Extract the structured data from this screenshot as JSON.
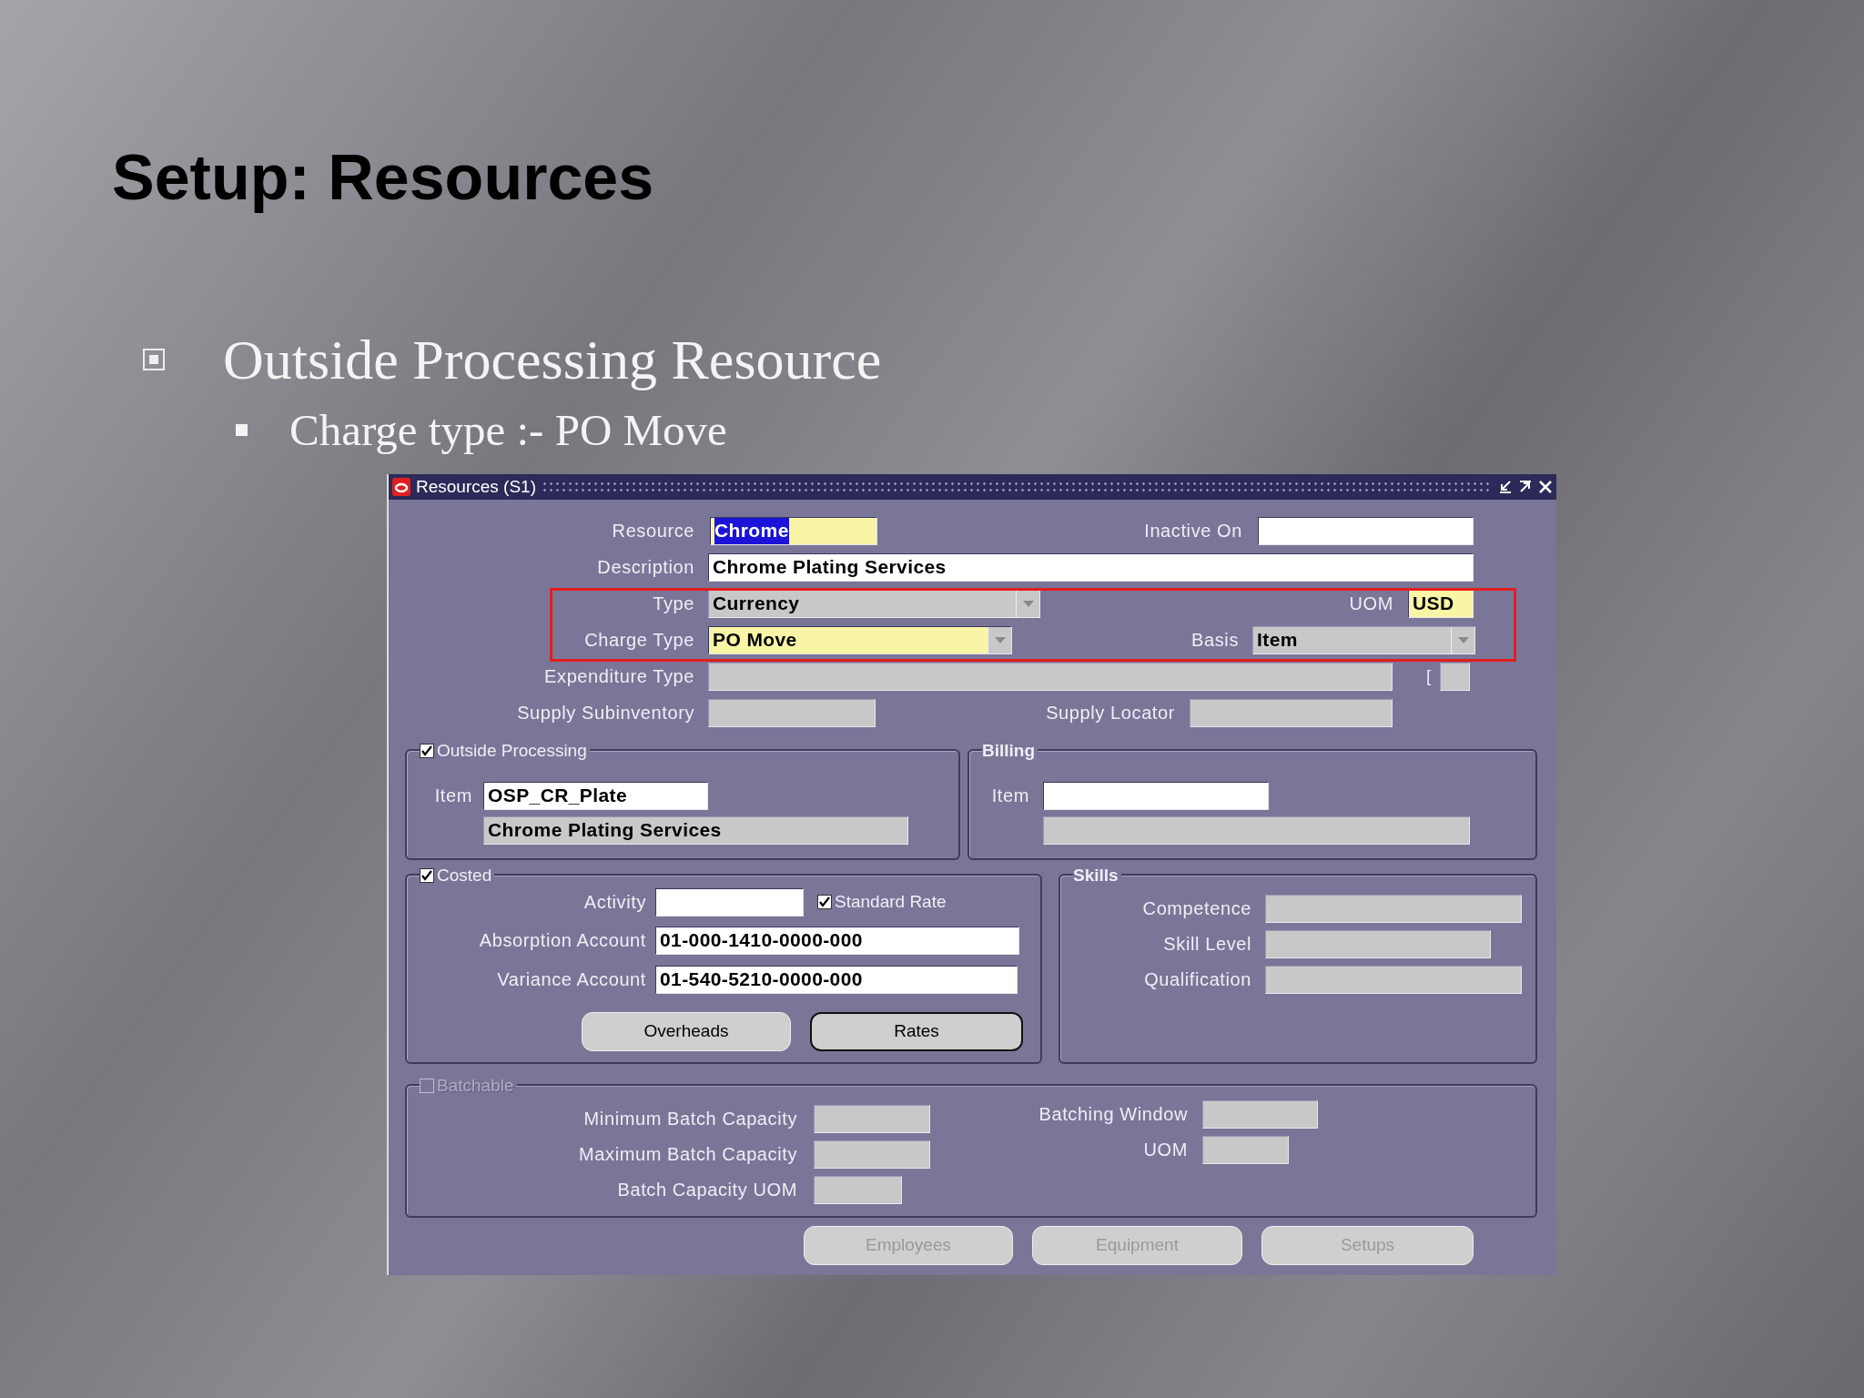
{
  "slide": {
    "title": "Setup: Resources",
    "bullets": [
      {
        "text": "Outside Processing Resource",
        "children": [
          {
            "text": "Charge type :- PO Move"
          }
        ]
      }
    ]
  },
  "window": {
    "title": "Resources (S1)",
    "resource": {
      "label": "Resource",
      "value": "Chrome",
      "dropdown": false,
      "required": true,
      "disabled": false,
      "highlighted": true
    },
    "inactive_on": {
      "label": "Inactive On",
      "dropdown": false,
      "required": false,
      "disabled": false
    },
    "description": {
      "label": "Description",
      "value": "Chrome Plating Services",
      "dropdown": false,
      "required": false,
      "disabled": false
    },
    "type": {
      "label": "Type",
      "value": "Currency",
      "dropdown": true,
      "required": false,
      "disabled": true
    },
    "uom": {
      "label": "UOM",
      "value": "USD",
      "dropdown": false,
      "required": true,
      "disabled": false
    },
    "charge_type": {
      "label": "Charge Type",
      "value": "PO Move",
      "dropdown": true,
      "required": true,
      "disabled": false
    },
    "basis": {
      "label": "Basis",
      "value": "Item",
      "dropdown": true,
      "required": false,
      "disabled": true
    },
    "expenditure_type": {
      "label": "Expenditure Type",
      "dropdown": false,
      "required": false,
      "disabled": true
    },
    "expenditure_bracket": "[",
    "expenditure_segment": {
      "dropdown": false,
      "required": false,
      "disabled": true
    },
    "supply_subinventory": {
      "label": "Supply Subinventory",
      "dropdown": false,
      "required": false,
      "disabled": true
    },
    "supply_locator": {
      "label": "Supply Locator",
      "dropdown": false,
      "required": false,
      "disabled": true
    },
    "outside_processing": {
      "label": "Outside Processing",
      "checked": true,
      "item": {
        "label": "Item",
        "value": "OSP_CR_Plate",
        "dropdown": false,
        "required": false,
        "disabled": false
      },
      "item_description": {
        "value": "Chrome Plating Services",
        "dropdown": false,
        "required": false,
        "disabled": true
      }
    },
    "billing": {
      "label": "Billing",
      "item": {
        "label": "Item",
        "dropdown": false,
        "required": false,
        "disabled": false
      },
      "item_description": {
        "dropdown": false,
        "required": false,
        "disabled": true
      }
    },
    "costed": {
      "label": "Costed",
      "checked": true,
      "activity": {
        "label": "Activity",
        "dropdown": false,
        "required": false,
        "disabled": false
      },
      "standard_rate": {
        "label": "Standard Rate",
        "checked": true
      },
      "absorption_account": {
        "label": "Absorption Account",
        "value": "01-000-1410-0000-000",
        "dropdown": false,
        "required": false,
        "disabled": false
      },
      "variance_account": {
        "label": "Variance Account",
        "value": "01-540-5210-0000-000",
        "dropdown": false,
        "required": false,
        "disabled": false
      },
      "buttons": [
        {
          "label": "Overheads",
          "default": false,
          "disabled": false
        },
        {
          "label": "Rates",
          "default": true,
          "disabled": false
        }
      ]
    },
    "skills": {
      "label": "Skills",
      "fields": [
        {
          "label": "Competence",
          "dropdown": false,
          "required": false,
          "disabled": true
        },
        {
          "label": "Skill Level",
          "dropdown": false,
          "required": false,
          "disabled": true
        },
        {
          "label": "Qualification",
          "dropdown": false,
          "required": false,
          "disabled": true
        }
      ]
    },
    "batchable": {
      "label": "Batchable",
      "checked": false,
      "disabled": true,
      "left_fields": [
        {
          "label": "Minimum Batch Capacity",
          "dropdown": false,
          "required": false,
          "disabled": true
        },
        {
          "label": "Maximum Batch Capacity",
          "dropdown": false,
          "required": false,
          "disabled": true
        },
        {
          "label": "Batch Capacity UOM",
          "dropdown": false,
          "required": false,
          "disabled": true
        }
      ],
      "right_fields": [
        {
          "label": "Batching Window",
          "dropdown": false,
          "required": false,
          "disabled": true
        },
        {
          "label": "UOM",
          "dropdown": false,
          "required": false,
          "disabled": true
        }
      ]
    },
    "buttons": [
      {
        "label": "Employees",
        "default": false,
        "disabled": true
      },
      {
        "label": "Equipment",
        "default": false,
        "disabled": true
      },
      {
        "label": "Setups",
        "default": false,
        "disabled": true
      }
    ]
  }
}
